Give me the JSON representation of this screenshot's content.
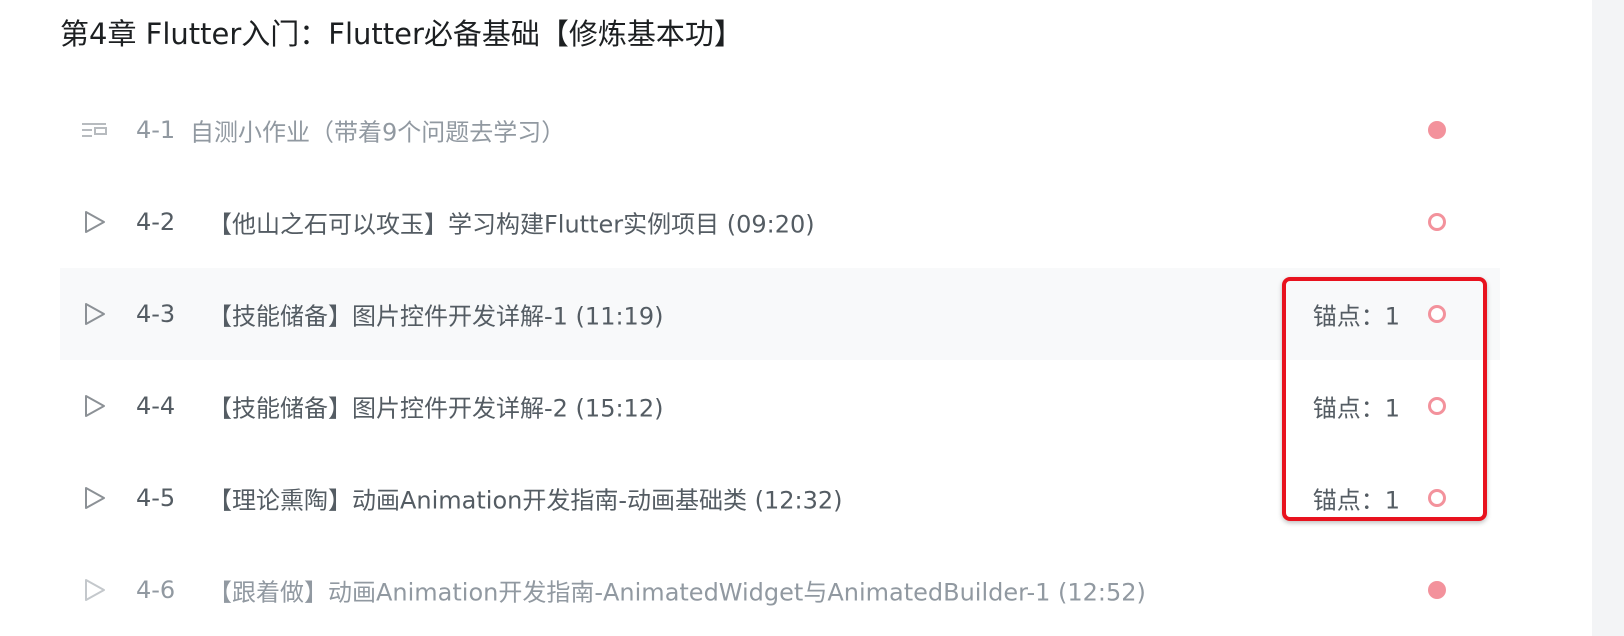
{
  "chapter": {
    "title": "第4章 Flutter入门：Flutter必备基础【修炼基本功】"
  },
  "lessons": [
    {
      "number": "4-1",
      "title": "自测小作业（带着9个问题去学习）",
      "anchor": "",
      "type_icon": "list-icon",
      "status": "filled"
    },
    {
      "number": "4-2",
      "title": "【他山之石可以攻玉】学习构建Flutter实例项目 (09:20)",
      "anchor": "",
      "type_icon": "play-icon",
      "status": "ring"
    },
    {
      "number": "4-3",
      "title": "【技能储备】图片控件开发详解-1 (11:19)",
      "anchor": "锚点：1",
      "type_icon": "play-icon",
      "status": "ring"
    },
    {
      "number": "4-4",
      "title": "【技能储备】图片控件开发详解-2 (15:12)",
      "anchor": "锚点：1",
      "type_icon": "play-icon",
      "status": "ring"
    },
    {
      "number": "4-5",
      "title": "【理论熏陶】动画Animation开发指南-动画基础类 (12:32)",
      "anchor": "锚点：1",
      "type_icon": "play-icon",
      "status": "ring"
    },
    {
      "number": "4-6",
      "title": "【跟着做】动画Animation开发指南-AnimatedWidget与AnimatedBuilder-1 (12:52)",
      "anchor": "",
      "type_icon": "play-icon",
      "status": "filled"
    }
  ],
  "colors": {
    "status_dot": "#f3929c",
    "highlight_box": "#e8121e",
    "hover_row": "#f8f9fa"
  }
}
